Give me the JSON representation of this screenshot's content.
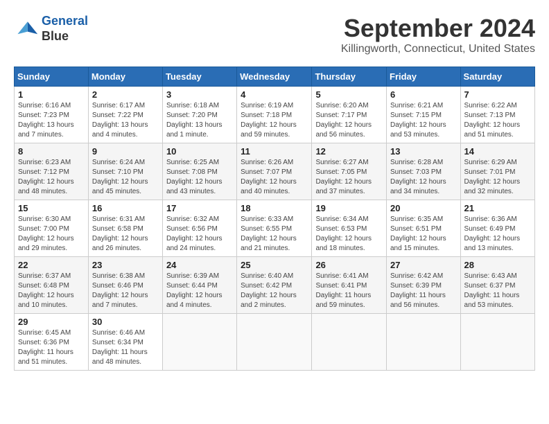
{
  "logo": {
    "line1": "General",
    "line2": "Blue"
  },
  "title": "September 2024",
  "subtitle": "Killingworth, Connecticut, United States",
  "days_of_week": [
    "Sunday",
    "Monday",
    "Tuesday",
    "Wednesday",
    "Thursday",
    "Friday",
    "Saturday"
  ],
  "weeks": [
    [
      {
        "day": "1",
        "sunrise": "6:16 AM",
        "sunset": "7:23 PM",
        "daylight": "13 hours and 7 minutes."
      },
      {
        "day": "2",
        "sunrise": "6:17 AM",
        "sunset": "7:22 PM",
        "daylight": "13 hours and 4 minutes."
      },
      {
        "day": "3",
        "sunrise": "6:18 AM",
        "sunset": "7:20 PM",
        "daylight": "13 hours and 1 minute."
      },
      {
        "day": "4",
        "sunrise": "6:19 AM",
        "sunset": "7:18 PM",
        "daylight": "12 hours and 59 minutes."
      },
      {
        "day": "5",
        "sunrise": "6:20 AM",
        "sunset": "7:17 PM",
        "daylight": "12 hours and 56 minutes."
      },
      {
        "day": "6",
        "sunrise": "6:21 AM",
        "sunset": "7:15 PM",
        "daylight": "12 hours and 53 minutes."
      },
      {
        "day": "7",
        "sunrise": "6:22 AM",
        "sunset": "7:13 PM",
        "daylight": "12 hours and 51 minutes."
      }
    ],
    [
      {
        "day": "8",
        "sunrise": "6:23 AM",
        "sunset": "7:12 PM",
        "daylight": "12 hours and 48 minutes."
      },
      {
        "day": "9",
        "sunrise": "6:24 AM",
        "sunset": "7:10 PM",
        "daylight": "12 hours and 45 minutes."
      },
      {
        "day": "10",
        "sunrise": "6:25 AM",
        "sunset": "7:08 PM",
        "daylight": "12 hours and 43 minutes."
      },
      {
        "day": "11",
        "sunrise": "6:26 AM",
        "sunset": "7:07 PM",
        "daylight": "12 hours and 40 minutes."
      },
      {
        "day": "12",
        "sunrise": "6:27 AM",
        "sunset": "7:05 PM",
        "daylight": "12 hours and 37 minutes."
      },
      {
        "day": "13",
        "sunrise": "6:28 AM",
        "sunset": "7:03 PM",
        "daylight": "12 hours and 34 minutes."
      },
      {
        "day": "14",
        "sunrise": "6:29 AM",
        "sunset": "7:01 PM",
        "daylight": "12 hours and 32 minutes."
      }
    ],
    [
      {
        "day": "15",
        "sunrise": "6:30 AM",
        "sunset": "7:00 PM",
        "daylight": "12 hours and 29 minutes."
      },
      {
        "day": "16",
        "sunrise": "6:31 AM",
        "sunset": "6:58 PM",
        "daylight": "12 hours and 26 minutes."
      },
      {
        "day": "17",
        "sunrise": "6:32 AM",
        "sunset": "6:56 PM",
        "daylight": "12 hours and 24 minutes."
      },
      {
        "day": "18",
        "sunrise": "6:33 AM",
        "sunset": "6:55 PM",
        "daylight": "12 hours and 21 minutes."
      },
      {
        "day": "19",
        "sunrise": "6:34 AM",
        "sunset": "6:53 PM",
        "daylight": "12 hours and 18 minutes."
      },
      {
        "day": "20",
        "sunrise": "6:35 AM",
        "sunset": "6:51 PM",
        "daylight": "12 hours and 15 minutes."
      },
      {
        "day": "21",
        "sunrise": "6:36 AM",
        "sunset": "6:49 PM",
        "daylight": "12 hours and 13 minutes."
      }
    ],
    [
      {
        "day": "22",
        "sunrise": "6:37 AM",
        "sunset": "6:48 PM",
        "daylight": "12 hours and 10 minutes."
      },
      {
        "day": "23",
        "sunrise": "6:38 AM",
        "sunset": "6:46 PM",
        "daylight": "12 hours and 7 minutes."
      },
      {
        "day": "24",
        "sunrise": "6:39 AM",
        "sunset": "6:44 PM",
        "daylight": "12 hours and 4 minutes."
      },
      {
        "day": "25",
        "sunrise": "6:40 AM",
        "sunset": "6:42 PM",
        "daylight": "12 hours and 2 minutes."
      },
      {
        "day": "26",
        "sunrise": "6:41 AM",
        "sunset": "6:41 PM",
        "daylight": "11 hours and 59 minutes."
      },
      {
        "day": "27",
        "sunrise": "6:42 AM",
        "sunset": "6:39 PM",
        "daylight": "11 hours and 56 minutes."
      },
      {
        "day": "28",
        "sunrise": "6:43 AM",
        "sunset": "6:37 PM",
        "daylight": "11 hours and 53 minutes."
      }
    ],
    [
      {
        "day": "29",
        "sunrise": "6:45 AM",
        "sunset": "6:36 PM",
        "daylight": "11 hours and 51 minutes."
      },
      {
        "day": "30",
        "sunrise": "6:46 AM",
        "sunset": "6:34 PM",
        "daylight": "11 hours and 48 minutes."
      },
      null,
      null,
      null,
      null,
      null
    ]
  ]
}
